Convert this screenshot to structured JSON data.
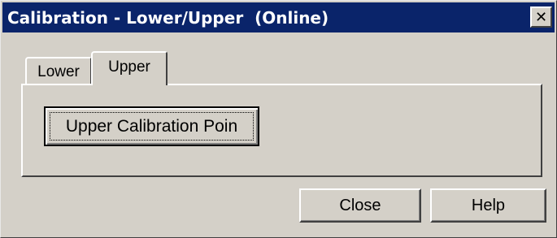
{
  "window": {
    "title": "Calibration - Lower/Upper  (Online)",
    "close_glyph": "✕"
  },
  "tabs": [
    {
      "label": "Lower",
      "selected": false
    },
    {
      "label": "Upper",
      "selected": true
    }
  ],
  "panel": {
    "calibration_button_label": "Upper Calibration Poin"
  },
  "footer": {
    "close_label": "Close",
    "help_label": "Help"
  },
  "colors": {
    "titlebar": "#0a246a",
    "face": "#d4d0c8",
    "title_text": "#ffffff"
  }
}
